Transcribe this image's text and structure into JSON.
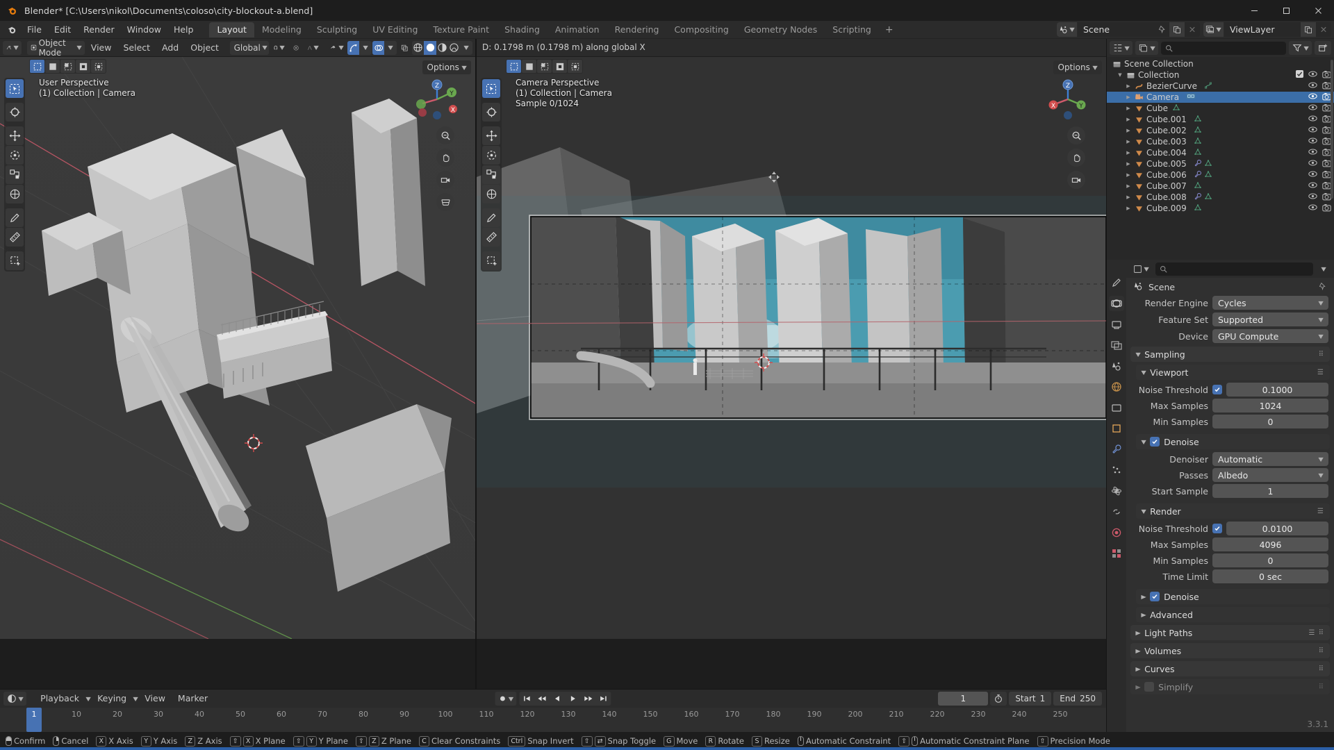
{
  "window": {
    "title": "Blender* [C:\\Users\\nikol\\Documents\\coloso\\city-blockout-a.blend]",
    "minimize": "─",
    "maximize": "☐",
    "close": "✕"
  },
  "topbar": {
    "menus": [
      "File",
      "Edit",
      "Render",
      "Window",
      "Help"
    ],
    "workspaces": [
      {
        "label": "Layout",
        "active": true
      },
      {
        "label": "Modeling",
        "active": false
      },
      {
        "label": "Sculpting",
        "active": false
      },
      {
        "label": "UV Editing",
        "active": false
      },
      {
        "label": "Texture Paint",
        "active": false
      },
      {
        "label": "Shading",
        "active": false
      },
      {
        "label": "Animation",
        "active": false
      },
      {
        "label": "Rendering",
        "active": false
      },
      {
        "label": "Compositing",
        "active": false
      },
      {
        "label": "Geometry Nodes",
        "active": false
      },
      {
        "label": "Scripting",
        "active": false
      }
    ],
    "add_workspace": "+",
    "scene_name": "Scene",
    "viewlayer_name": "ViewLayer"
  },
  "viewport_header": {
    "mode": "Object Mode",
    "menus": [
      "View",
      "Select",
      "Add",
      "Object"
    ],
    "transform_orientation": "Global"
  },
  "viewport_left": {
    "perspective": "User Perspective",
    "collection": "(1) Collection | Camera",
    "options": "Options"
  },
  "viewport_right": {
    "modal_status": "D: 0.1798 m (0.1798 m) along global X",
    "perspective": "Camera Perspective",
    "collection": "(1) Collection | Camera",
    "sample": "Sample 0/1024",
    "options": "Options"
  },
  "timeline": {
    "editor_menus": [
      "Playback",
      "Keying",
      "View",
      "Marker"
    ],
    "current_frame": "1",
    "start_label": "Start",
    "start_value": "1",
    "end_label": "End",
    "end_value": "250",
    "ticks": [
      "10",
      "20",
      "30",
      "40",
      "50",
      "60",
      "70",
      "80",
      "90",
      "100",
      "110",
      "120",
      "130",
      "140",
      "150",
      "160",
      "170",
      "180",
      "190",
      "200",
      "210",
      "220",
      "230",
      "240",
      "250"
    ],
    "playhead_frame": "1"
  },
  "outliner": {
    "scene_collection": "Scene Collection",
    "collection": "Collection",
    "search_placeholder": "",
    "items": [
      {
        "name": "BezierCurve",
        "type": "curve",
        "selected": false,
        "data": [
          "curve"
        ]
      },
      {
        "name": "Camera",
        "type": "camera",
        "selected": true,
        "data": [
          "camera"
        ]
      },
      {
        "name": "Cube",
        "type": "mesh",
        "selected": false,
        "data": [
          "mesh"
        ]
      },
      {
        "name": "Cube.001",
        "type": "mesh",
        "selected": false,
        "data": [
          "mesh"
        ]
      },
      {
        "name": "Cube.002",
        "type": "mesh",
        "selected": false,
        "data": [
          "mesh"
        ]
      },
      {
        "name": "Cube.003",
        "type": "mesh",
        "selected": false,
        "data": [
          "mesh"
        ]
      },
      {
        "name": "Cube.004",
        "type": "mesh",
        "selected": false,
        "data": [
          "mesh"
        ]
      },
      {
        "name": "Cube.005",
        "type": "mesh",
        "selected": false,
        "data": [
          "modifier",
          "mesh"
        ]
      },
      {
        "name": "Cube.006",
        "type": "mesh",
        "selected": false,
        "data": [
          "modifier",
          "mesh"
        ]
      },
      {
        "name": "Cube.007",
        "type": "mesh",
        "selected": false,
        "data": [
          "mesh"
        ]
      },
      {
        "name": "Cube.008",
        "type": "mesh",
        "selected": false,
        "data": [
          "modifier",
          "mesh"
        ]
      },
      {
        "name": "Cube.009",
        "type": "mesh",
        "selected": false,
        "data": [
          "mesh"
        ]
      }
    ]
  },
  "properties": {
    "breadcrumb": "Scene",
    "render_engine_label": "Render Engine",
    "render_engine_value": "Cycles",
    "feature_set_label": "Feature Set",
    "feature_set_value": "Supported",
    "device_label": "Device",
    "device_value": "GPU Compute",
    "sampling_label": "Sampling",
    "viewport_label": "Viewport",
    "viewport_noise_label": "Noise Threshold",
    "viewport_noise_value": "0.1000",
    "viewport_max_label": "Max Samples",
    "viewport_max_value": "1024",
    "viewport_min_label": "Min Samples",
    "viewport_min_value": "0",
    "denoise_label": "Denoise",
    "denoiser_label": "Denoiser",
    "denoiser_value": "Automatic",
    "passes_label": "Passes",
    "passes_value": "Albedo",
    "start_sample_label": "Start Sample",
    "start_sample_value": "1",
    "render_label": "Render",
    "render_noise_label": "Noise Threshold",
    "render_noise_value": "0.0100",
    "render_max_label": "Max Samples",
    "render_max_value": "4096",
    "render_min_label": "Min Samples",
    "render_min_value": "0",
    "time_limit_label": "Time Limit",
    "time_limit_value": "0 sec",
    "render_denoise_label": "Denoise",
    "advanced_label": "Advanced",
    "light_paths_label": "Light Paths",
    "volumes_label": "Volumes",
    "curves_label": "Curves",
    "simplify_label": "Simplify",
    "version": "3.3.1"
  },
  "statusbar": {
    "items": [
      {
        "keys": [
          "mouse-left"
        ],
        "label": "Confirm"
      },
      {
        "keys": [
          "mouse-right"
        ],
        "label": "Cancel"
      },
      {
        "keys": [
          "X"
        ],
        "label": "X Axis"
      },
      {
        "keys": [
          "Y"
        ],
        "label": "Y Axis"
      },
      {
        "keys": [
          "Z"
        ],
        "label": "Z Axis"
      },
      {
        "keys": [
          "⇧",
          "X"
        ],
        "label": "X Plane"
      },
      {
        "keys": [
          "⇧",
          "Y"
        ],
        "label": "Y Plane"
      },
      {
        "keys": [
          "⇧",
          "Z"
        ],
        "label": "Z Plane"
      },
      {
        "keys": [
          "C"
        ],
        "label": "Clear Constraints"
      },
      {
        "keys": [
          "Ctrl"
        ],
        "label": "Snap Invert"
      },
      {
        "keys": [
          "⇧",
          "snap"
        ],
        "label": "Snap Toggle"
      },
      {
        "keys": [
          "G"
        ],
        "label": "Move"
      },
      {
        "keys": [
          "R"
        ],
        "label": "Rotate"
      },
      {
        "keys": [
          "S"
        ],
        "label": "Resize"
      },
      {
        "keys": [
          "mouse-mid"
        ],
        "label": "Automatic Constraint"
      },
      {
        "keys": [
          "⇧",
          "mouse-mid"
        ],
        "label": "Automatic Constraint Plane"
      },
      {
        "keys": [
          "⇧"
        ],
        "label": "Precision Mode"
      }
    ]
  }
}
